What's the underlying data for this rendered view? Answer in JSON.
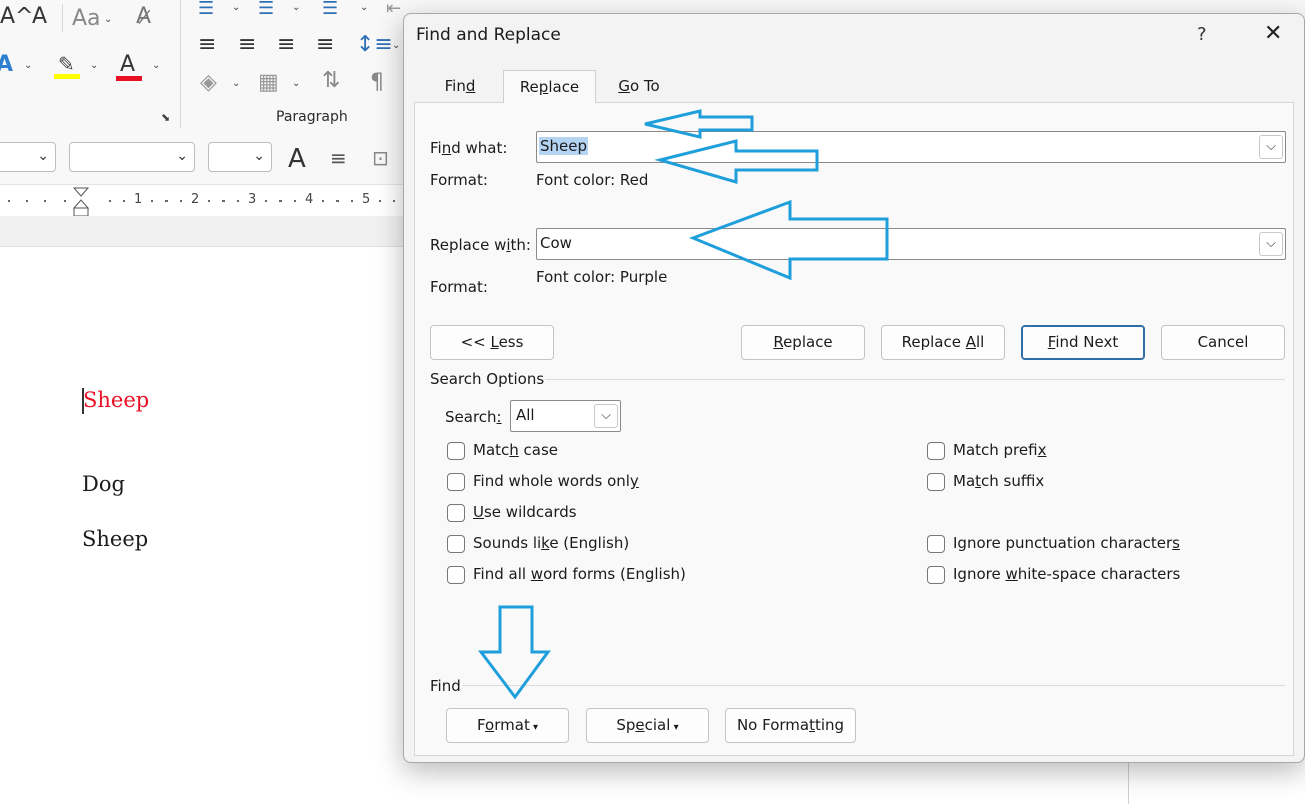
{
  "ribbon": {
    "paragraph_group_label": "Paragraph",
    "font_size_up": "A^",
    "font_size_down": "A",
    "change_case": "Aa"
  },
  "document": {
    "words": [
      "Sheep",
      "Dog",
      "Sheep"
    ],
    "first_word_color": "#e81123",
    "ruler_numbers": [
      "1",
      "2",
      "3",
      "4",
      "5"
    ]
  },
  "dialog": {
    "title": "Find and Replace",
    "help": "?",
    "close": "✕",
    "tabs": [
      {
        "pre": "Fin",
        "u": "d",
        "post": ""
      },
      {
        "pre": "Re",
        "u": "p",
        "post": "lace"
      },
      {
        "pre": "",
        "u": "G",
        "post": "o To"
      }
    ],
    "find_label": {
      "pre": "Fi",
      "u": "n",
      "post": "d what:"
    },
    "find_value": "Sheep",
    "find_format_label": "Format:",
    "find_format_value": "Font color: Red",
    "replace_label": {
      "pre": "Replace w",
      "u": "i",
      "post": "th:"
    },
    "replace_value": "Cow",
    "replace_format_label": "Format:",
    "replace_format_value": "Font color: Purple",
    "buttons": {
      "less": {
        "pre": "<< ",
        "u": "L",
        "post": "ess"
      },
      "replace": {
        "pre": "",
        "u": "R",
        "post": "eplace"
      },
      "replace_all": {
        "pre": "Replace ",
        "u": "A",
        "post": "ll"
      },
      "find_next": {
        "pre": "",
        "u": "F",
        "post": "ind Next"
      },
      "cancel": "Cancel"
    },
    "search_options_title": "Search Options",
    "search_label": {
      "pre": "Search",
      "u": ":",
      "post": ""
    },
    "search_value": "All",
    "options_left": [
      {
        "pre": "Matc",
        "u": "h",
        "post": " case"
      },
      {
        "pre": "Find whole words onl",
        "u": "y",
        "post": ""
      },
      {
        "pre": "",
        "u": "U",
        "post": "se wildcards"
      },
      {
        "pre": "Sounds li",
        "u": "k",
        "post": "e (English)"
      },
      {
        "pre": "Find all ",
        "u": "w",
        "post": "ord forms (English)"
      }
    ],
    "options_right": [
      {
        "pre": "Match prefi",
        "u": "x",
        "post": ""
      },
      {
        "pre": "Ma",
        "u": "t",
        "post": "ch suffix"
      },
      {
        "pre": "Ignore punctuation character",
        "u": "s",
        "post": ""
      },
      {
        "pre": "Ignore ",
        "u": "w",
        "post": "hite-space characters"
      }
    ],
    "find_section_title": "Find",
    "bottom_buttons": {
      "format": {
        "pre": "F",
        "u": "o",
        "post": "rmat"
      },
      "special": {
        "pre": "Sp",
        "u": "e",
        "post": "cial"
      },
      "no_formatting": {
        "pre": "No Forma",
        "u": "t",
        "post": "ting"
      }
    }
  },
  "colors": {
    "annotation_arrow": "#1e9fdc",
    "default_button_border": "#2e6da8",
    "selection": "#b5d3f3"
  }
}
